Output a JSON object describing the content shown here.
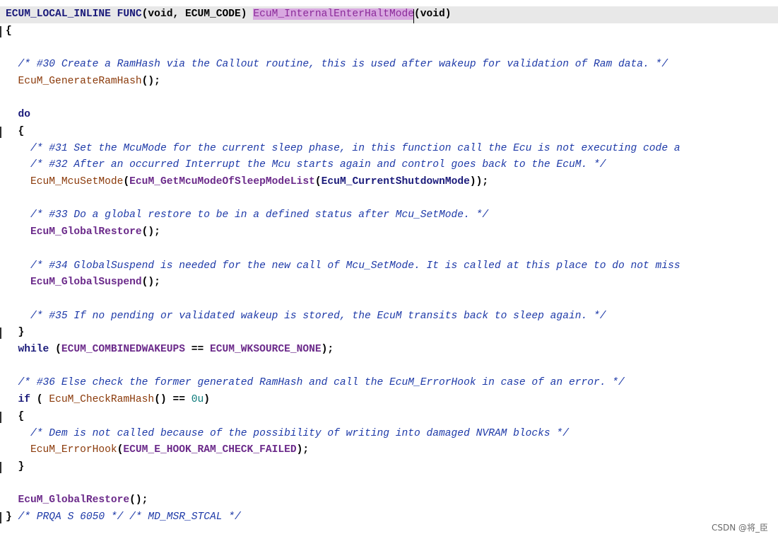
{
  "editor": {
    "top_fragment": "/",
    "lines": [
      {
        "fold": false,
        "current": true,
        "tokens": [
          {
            "t": "ECUM_LOCAL_INLINE FUNC",
            "c": "tok-t"
          },
          {
            "t": "(void, ECUM_CODE) ",
            "c": "tok-p"
          },
          {
            "t": "EcuM_InternalEnterHaltMode",
            "c": "tok-hl"
          },
          {
            "t": "(void)",
            "c": "tok-p"
          }
        ]
      },
      {
        "fold": true,
        "tokens": [
          {
            "t": "{",
            "c": "tok-p"
          }
        ]
      },
      {
        "fold": false,
        "tokens": []
      },
      {
        "fold": false,
        "tokens": [
          {
            "t": "  /* #30 Create a RamHash via the Callout routine, this is used after wakeup for validation of Ram data. */",
            "c": "tok-c"
          }
        ]
      },
      {
        "fold": false,
        "tokens": [
          {
            "t": "  ",
            "c": "tok-p"
          },
          {
            "t": "EcuM_GenerateRamHash",
            "c": "tok-f"
          },
          {
            "t": "();",
            "c": "tok-p"
          }
        ]
      },
      {
        "fold": false,
        "tokens": []
      },
      {
        "fold": false,
        "tokens": [
          {
            "t": "  do",
            "c": "tok-k"
          }
        ]
      },
      {
        "fold": true,
        "tokens": [
          {
            "t": "  {",
            "c": "tok-p"
          }
        ]
      },
      {
        "fold": false,
        "tokens": [
          {
            "t": "    /* #31 Set the McuMode for the current sleep phase, in this function call the Ecu is not executing code a",
            "c": "tok-c"
          }
        ]
      },
      {
        "fold": false,
        "tokens": [
          {
            "t": "    /* #32 After an occurred Interrupt the Mcu starts again and control goes back to the EcuM. */",
            "c": "tok-c"
          }
        ]
      },
      {
        "fold": false,
        "tokens": [
          {
            "t": "    ",
            "c": "tok-p"
          },
          {
            "t": "EcuM_McuSetMode",
            "c": "tok-f"
          },
          {
            "t": "(",
            "c": "tok-p"
          },
          {
            "t": "EcuM_GetMcuModeOfSleepModeList",
            "c": "tok-m"
          },
          {
            "t": "(",
            "c": "tok-p"
          },
          {
            "t": "EcuM_CurrentShutdownMode",
            "c": "tok-t"
          },
          {
            "t": "));",
            "c": "tok-p"
          }
        ]
      },
      {
        "fold": false,
        "tokens": []
      },
      {
        "fold": false,
        "tokens": [
          {
            "t": "    /* #33 Do a global restore to be in a defined status after Mcu_SetMode. */",
            "c": "tok-c"
          }
        ]
      },
      {
        "fold": false,
        "tokens": [
          {
            "t": "    ",
            "c": "tok-p"
          },
          {
            "t": "EcuM_GlobalRestore",
            "c": "tok-m"
          },
          {
            "t": "();",
            "c": "tok-p"
          }
        ]
      },
      {
        "fold": false,
        "tokens": []
      },
      {
        "fold": false,
        "tokens": [
          {
            "t": "    /* #34 GlobalSuspend is needed for the new call of Mcu_SetMode. It is called at this place to do not miss",
            "c": "tok-c"
          }
        ]
      },
      {
        "fold": false,
        "tokens": [
          {
            "t": "    ",
            "c": "tok-p"
          },
          {
            "t": "EcuM_GlobalSuspend",
            "c": "tok-m"
          },
          {
            "t": "();",
            "c": "tok-p"
          }
        ]
      },
      {
        "fold": false,
        "tokens": []
      },
      {
        "fold": false,
        "tokens": [
          {
            "t": "    /* #35 If no pending or validated wakeup is stored, the EcuM transits back to sleep again. */",
            "c": "tok-c"
          }
        ]
      },
      {
        "fold": true,
        "tokens": [
          {
            "t": "  }",
            "c": "tok-p"
          }
        ]
      },
      {
        "fold": false,
        "tokens": [
          {
            "t": "  while",
            "c": "tok-k"
          },
          {
            "t": " (",
            "c": "tok-p"
          },
          {
            "t": "ECUM_COMBINEDWAKEUPS",
            "c": "tok-m"
          },
          {
            "t": " == ",
            "c": "tok-p"
          },
          {
            "t": "ECUM_WKSOURCE_NONE",
            "c": "tok-m"
          },
          {
            "t": ");",
            "c": "tok-p"
          }
        ]
      },
      {
        "fold": false,
        "tokens": []
      },
      {
        "fold": false,
        "tokens": [
          {
            "t": "  /* #36 Else check the former generated RamHash and call the EcuM_ErrorHook in case of an error. */",
            "c": "tok-c"
          }
        ]
      },
      {
        "fold": false,
        "tokens": [
          {
            "t": "  if",
            "c": "tok-k"
          },
          {
            "t": " ( ",
            "c": "tok-p"
          },
          {
            "t": "EcuM_CheckRamHash",
            "c": "tok-f"
          },
          {
            "t": "() == ",
            "c": "tok-p"
          },
          {
            "t": "0u",
            "c": "tok-n"
          },
          {
            "t": ")",
            "c": "tok-p"
          }
        ]
      },
      {
        "fold": true,
        "tokens": [
          {
            "t": "  {",
            "c": "tok-p"
          }
        ]
      },
      {
        "fold": false,
        "tokens": [
          {
            "t": "    /* Dem is not called because of the possibility of writing into damaged NVRAM blocks */",
            "c": "tok-c"
          }
        ]
      },
      {
        "fold": false,
        "tokens": [
          {
            "t": "    ",
            "c": "tok-p"
          },
          {
            "t": "EcuM_ErrorHook",
            "c": "tok-f"
          },
          {
            "t": "(",
            "c": "tok-p"
          },
          {
            "t": "ECUM_E_HOOK_RAM_CHECK_FAILED",
            "c": "tok-m"
          },
          {
            "t": ");",
            "c": "tok-p"
          }
        ]
      },
      {
        "fold": true,
        "tokens": [
          {
            "t": "  }",
            "c": "tok-p"
          }
        ]
      },
      {
        "fold": false,
        "tokens": []
      },
      {
        "fold": false,
        "tokens": [
          {
            "t": "  ",
            "c": "tok-p"
          },
          {
            "t": "EcuM_GlobalRestore",
            "c": "tok-m"
          },
          {
            "t": "();",
            "c": "tok-p"
          }
        ]
      },
      {
        "fold": true,
        "tokens": [
          {
            "t": "} ",
            "c": "tok-p"
          },
          {
            "t": "/* PRQA S 6050 */ /* MD_MSR_STCAL */",
            "c": "tok-c"
          }
        ]
      }
    ]
  },
  "watermark": "CSDN @将_臣"
}
